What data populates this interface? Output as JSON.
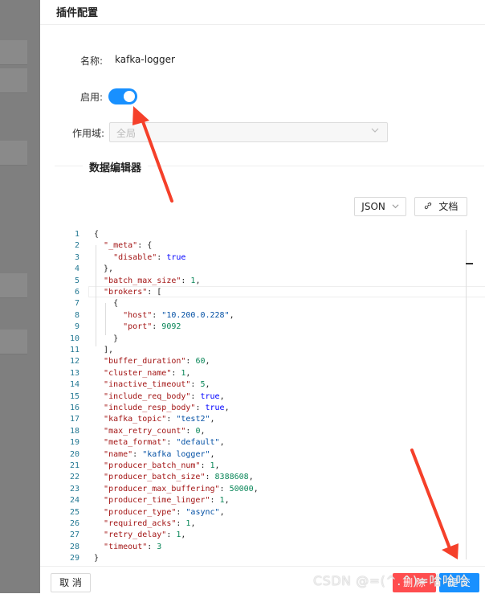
{
  "drawer": {
    "title": "插件配置"
  },
  "form": {
    "name_label": "名称:",
    "name_value": "kafka-logger",
    "enable_label": "启用:",
    "enable_on": true,
    "scope_label": "作用域:",
    "scope_placeholder": "全局"
  },
  "editor": {
    "section_title": "数据编辑器",
    "format_button": "JSON",
    "docs_button": "文档",
    "lines": [
      {
        "no": "1",
        "html": "{"
      },
      {
        "no": "2",
        "html": "  <span class=\"k\">\"_meta\"</span>: {"
      },
      {
        "no": "3",
        "html": "    <span class=\"k\">\"disable\"</span>: <span class=\"b\">true</span>"
      },
      {
        "no": "4",
        "html": "  },"
      },
      {
        "no": "5",
        "html": "  <span class=\"k\">\"batch_max_size\"</span>: <span class=\"n\">1</span>,"
      },
      {
        "no": "6",
        "html": "  <span class=\"k\">\"brokers\"</span>: ["
      },
      {
        "no": "7",
        "html": "    {"
      },
      {
        "no": "8",
        "html": "      <span class=\"k\">\"host\"</span>: <span class=\"s\">\"10.200.0.228\"</span>,"
      },
      {
        "no": "9",
        "html": "      <span class=\"k\">\"port\"</span>: <span class=\"n\">9092</span>"
      },
      {
        "no": "10",
        "html": "    }"
      },
      {
        "no": "11",
        "html": "  ],"
      },
      {
        "no": "12",
        "html": "  <span class=\"k\">\"buffer_duration\"</span>: <span class=\"n\">60</span>,"
      },
      {
        "no": "13",
        "html": "  <span class=\"k\">\"cluster_name\"</span>: <span class=\"n\">1</span>,"
      },
      {
        "no": "14",
        "html": "  <span class=\"k\">\"inactive_timeout\"</span>: <span class=\"n\">5</span>,"
      },
      {
        "no": "15",
        "html": "  <span class=\"k\">\"include_req_body\"</span>: <span class=\"b\">true</span>,"
      },
      {
        "no": "16",
        "html": "  <span class=\"k\">\"include_resp_body\"</span>: <span class=\"b\">true</span>,"
      },
      {
        "no": "17",
        "html": "  <span class=\"k\">\"kafka_topic\"</span>: <span class=\"s\">\"test2\"</span>,"
      },
      {
        "no": "18",
        "html": "  <span class=\"k\">\"max_retry_count\"</span>: <span class=\"n\">0</span>,"
      },
      {
        "no": "19",
        "html": "  <span class=\"k\">\"meta_format\"</span>: <span class=\"s\">\"default\"</span>,"
      },
      {
        "no": "20",
        "html": "  <span class=\"k\">\"name\"</span>: <span class=\"s\">\"kafka logger\"</span>,"
      },
      {
        "no": "21",
        "html": "  <span class=\"k\">\"producer_batch_num\"</span>: <span class=\"n\">1</span>,"
      },
      {
        "no": "22",
        "html": "  <span class=\"k\">\"producer_batch_size\"</span>: <span class=\"n\">8388608</span>,"
      },
      {
        "no": "23",
        "html": "  <span class=\"k\">\"producer_max_buffering\"</span>: <span class=\"n\">50000</span>,"
      },
      {
        "no": "24",
        "html": "  <span class=\"k\">\"producer_time_linger\"</span>: <span class=\"n\">1</span>,"
      },
      {
        "no": "25",
        "html": "  <span class=\"k\">\"producer_type\"</span>: <span class=\"s\">\"async\"</span>,"
      },
      {
        "no": "26",
        "html": "  <span class=\"k\">\"required_acks\"</span>: <span class=\"n\">1</span>,"
      },
      {
        "no": "27",
        "html": "  <span class=\"k\">\"retry_delay\"</span>: <span class=\"n\">1</span>,"
      },
      {
        "no": "28",
        "html": "  <span class=\"k\">\"timeout\"</span>: <span class=\"n\">3</span>"
      },
      {
        "no": "29",
        "html": "}"
      }
    ]
  },
  "footer": {
    "cancel_label": "取 消",
    "delete_label": "删 除",
    "submit_label": "提 交"
  },
  "watermark": "CSDN @=(^.^)=哈哈哈",
  "colors": {
    "primary": "#1890ff",
    "danger": "#ff4d4f",
    "annotation": "#f5402a"
  }
}
